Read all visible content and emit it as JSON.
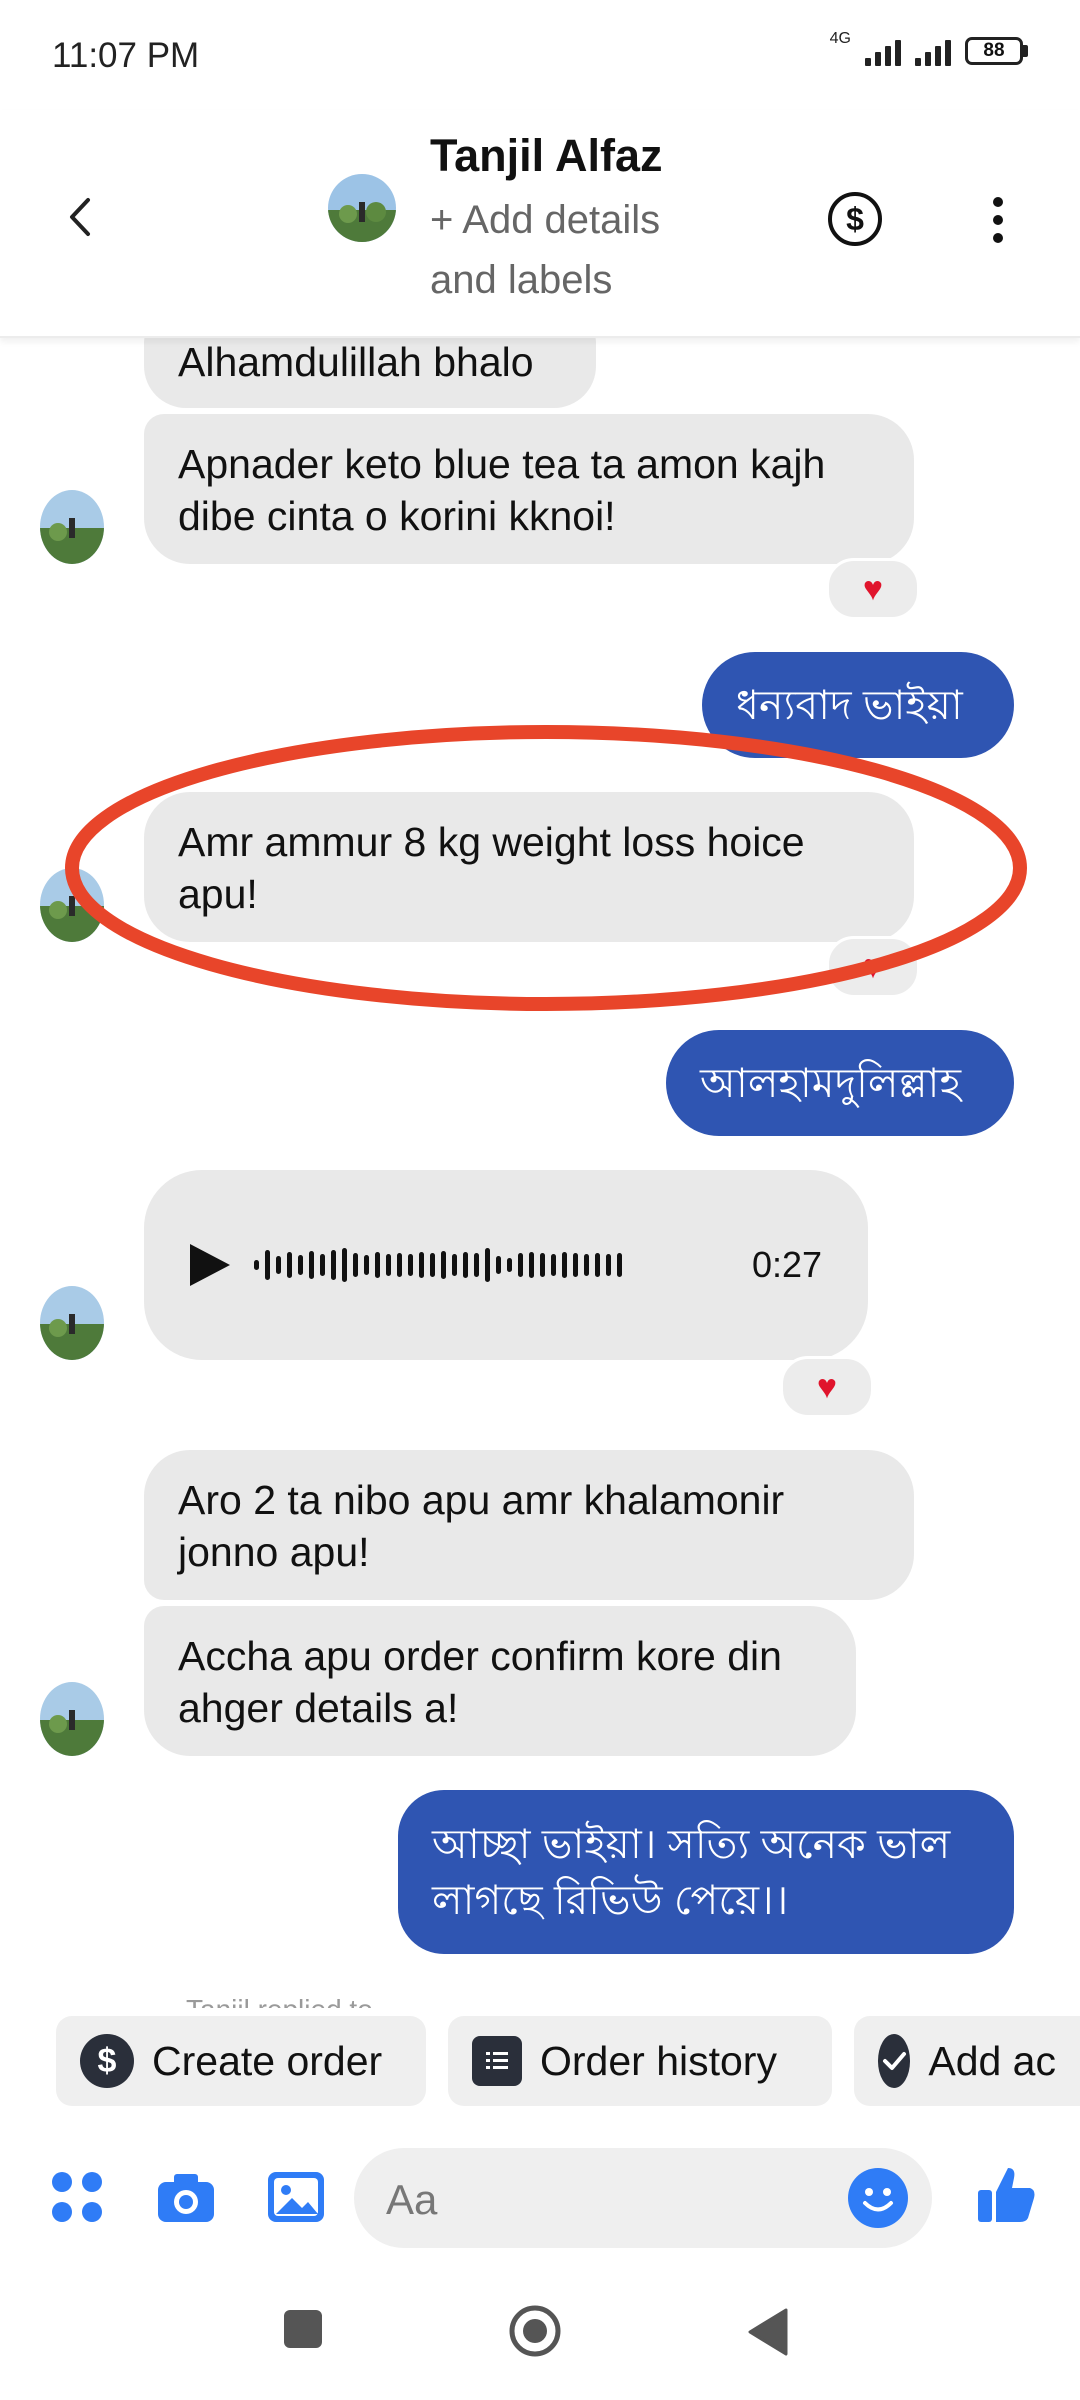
{
  "status_bar": {
    "time": "11:07 PM",
    "network": "4G",
    "battery": "88"
  },
  "header": {
    "name": "Tanjil Alfaz",
    "subtitle": "+ Add details and labels"
  },
  "messages": [
    {
      "text": "Alhamdulillah bhalo"
    },
    {
      "text": "Apnader keto blue tea ta amon kajh dibe cinta o korini kknoi!"
    },
    {
      "text": "ধন্যবাদ ভাইয়া"
    },
    {
      "text": "Amr ammur 8 kg weight loss hoice apu!"
    },
    {
      "text": "আলহামদুলিল্লাহ"
    },
    {
      "text": "Aro 2 ta nibo apu amr khalamonir jonno apu!"
    },
    {
      "text": "Accha apu order confirm kore din ahger details a!"
    },
    {
      "text": "আচ্ছা ভাইয়া। সত্যি অনেক ভাল লাগছে রিভিউ পেয়ে।।"
    }
  ],
  "audio": {
    "duration": "0:27"
  },
  "reply_hint": "Tanjil replied to ...",
  "chips": [
    {
      "label": "Create order"
    },
    {
      "label": "Order history"
    },
    {
      "label": "Add ac"
    }
  ],
  "composer": {
    "placeholder": "Aa"
  },
  "colors": {
    "outgoing": "#2f55b2",
    "incoming": "#e9e9e9",
    "accent": "#2f7cf6",
    "highlight": "#e8452a"
  }
}
